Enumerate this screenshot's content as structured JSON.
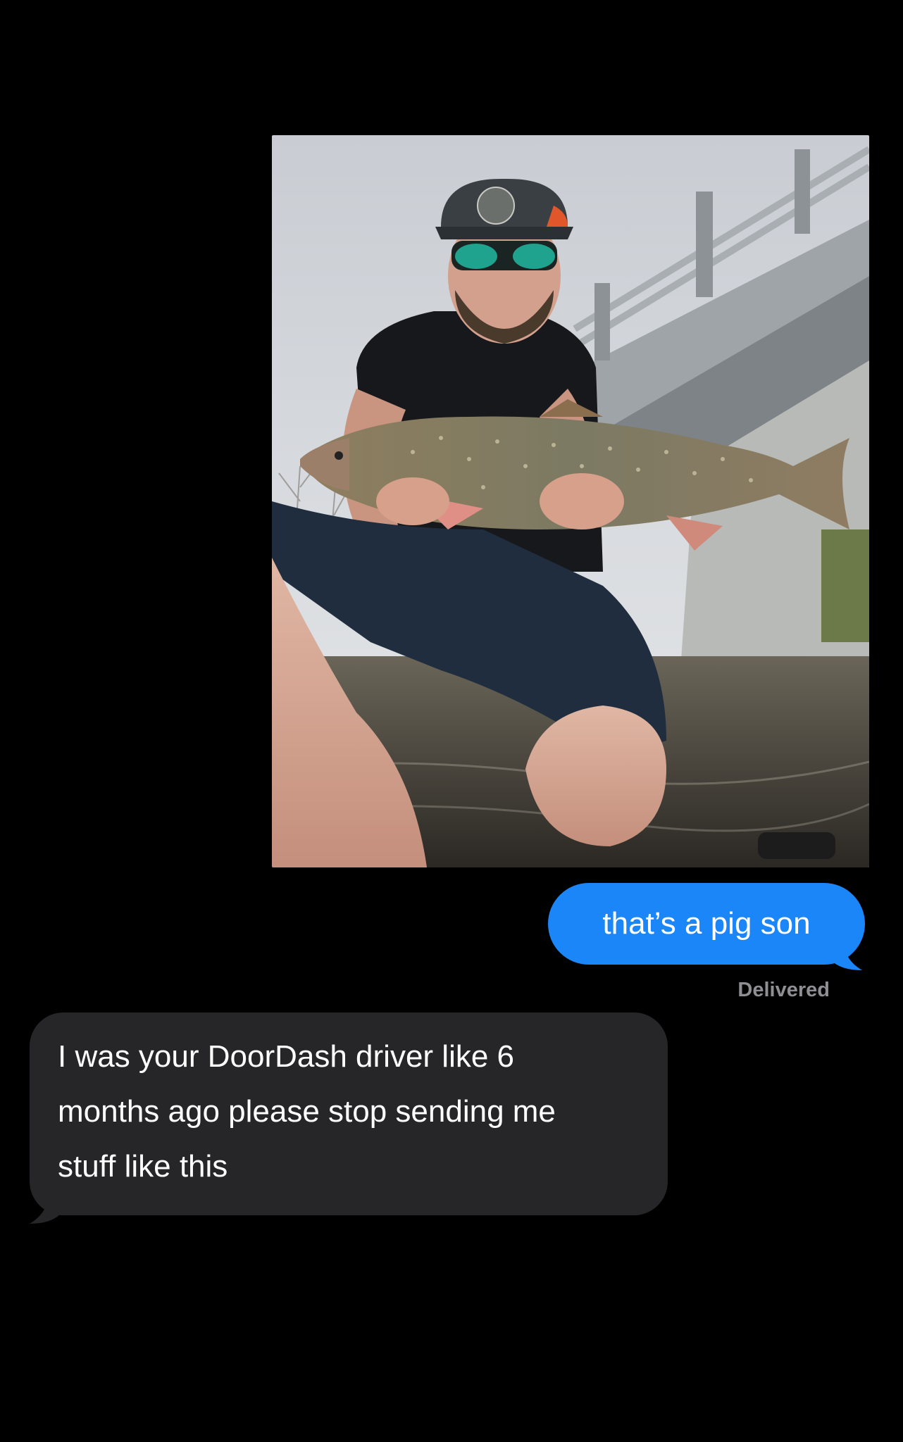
{
  "conversation": {
    "photo": {
      "alt": "",
      "colors": {
        "sky": "#d9dde3",
        "bridge": "#8d9396",
        "shirt": "#16181c",
        "shorts": "#1f2d3e",
        "fish": "#7f7a61",
        "water": "#3d3a33",
        "skin": "#d7a48e"
      }
    },
    "outgoing": {
      "text": "that’s a pig son",
      "color": "#1b86f8",
      "receipt": "Delivered"
    },
    "incoming": {
      "lines": [
        "I was your DoorDash driver like 6",
        "months ago please stop sending me",
        "stuff like this"
      ],
      "color": "#262629"
    }
  }
}
